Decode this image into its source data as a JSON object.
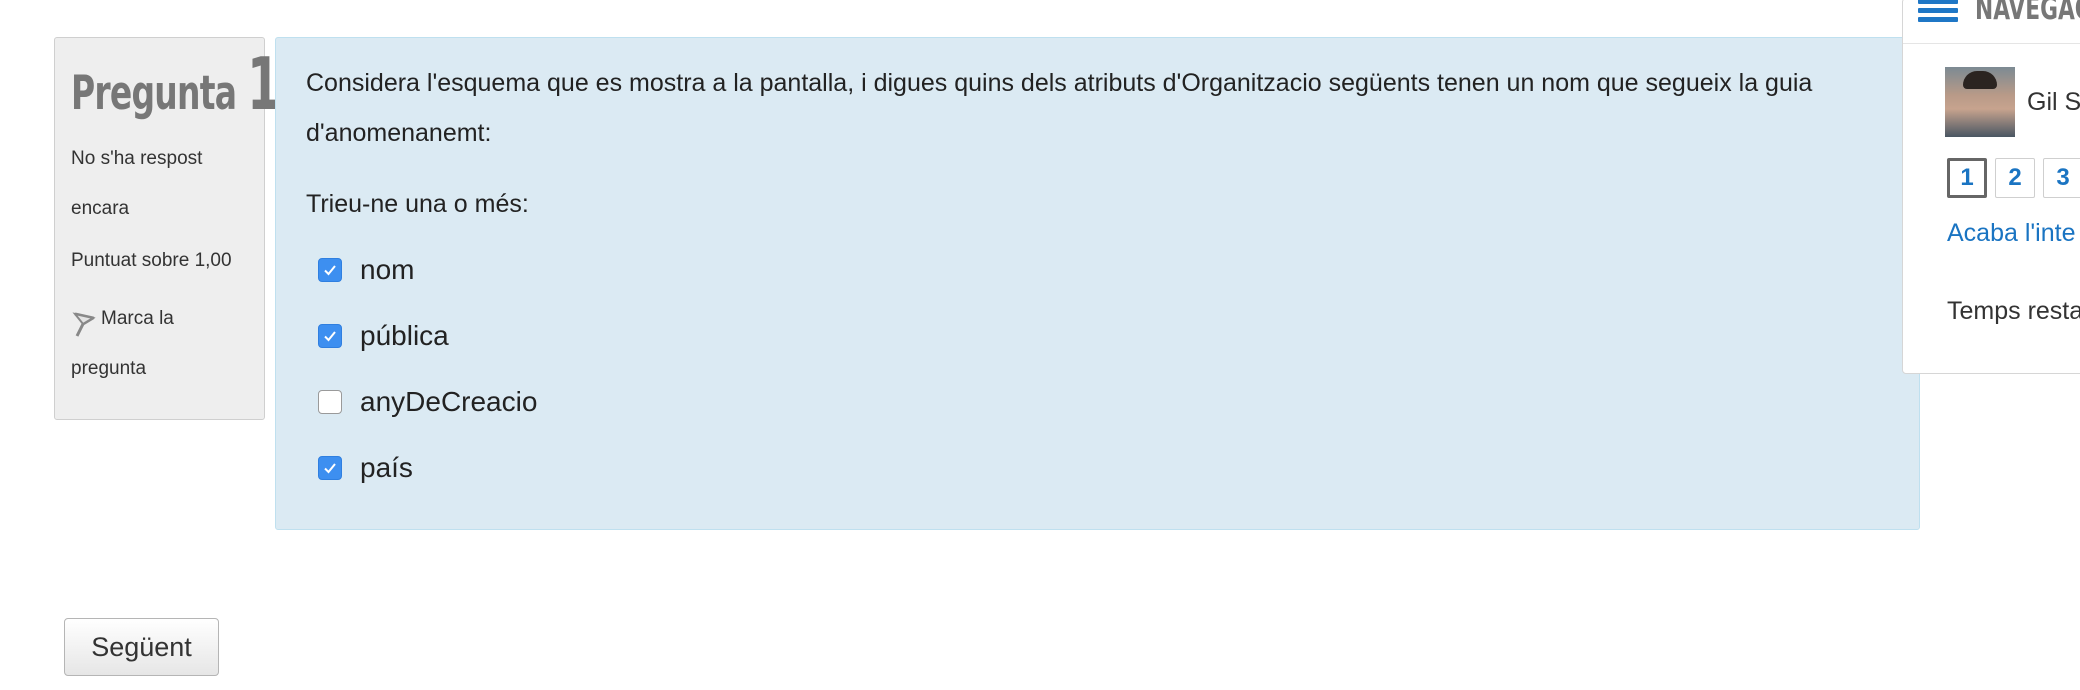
{
  "question": {
    "title_word": "Pregunta",
    "number": "1",
    "state": "No s'ha respost encara",
    "grade": "Puntuat sobre 1,00",
    "flag_label": "Marca la pregunta",
    "text": "Considera l'esquema que es mostra a la pantalla, i digues quins dels atributs d'Organitzacio següents tenen un nom que segueix la guia d'anomenanemt:",
    "prompt": "Trieu-ne una o més:",
    "answers": [
      {
        "label": "nom",
        "checked": true
      },
      {
        "label": "pública",
        "checked": true
      },
      {
        "label": "anyDeCreacio",
        "checked": false
      },
      {
        "label": "país",
        "checked": true
      }
    ]
  },
  "next_button": "Següent",
  "navigation": {
    "title": "NAVEGACIÓ",
    "user_name": "Gil S",
    "question_buttons": [
      "1",
      "2",
      "3"
    ],
    "finish_link": "Acaba l'inte",
    "timer_label": "Temps resta"
  },
  "colors": {
    "content_bg": "#dbeaf3",
    "info_bg": "#eeeeee",
    "checkbox_checked": "#3d8ff0",
    "link": "#1a74c2"
  }
}
